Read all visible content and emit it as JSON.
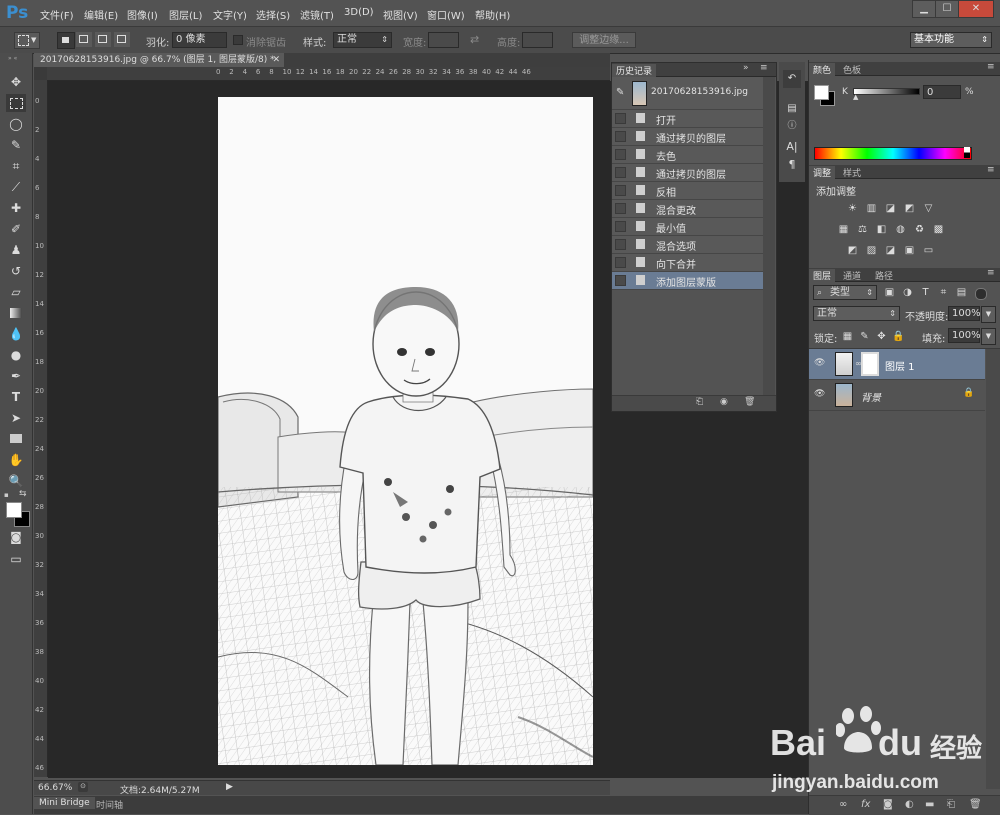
{
  "app": {
    "logo": "Ps"
  },
  "menu": [
    "文件(F)",
    "编辑(E)",
    "图像(I)",
    "图层(L)",
    "文字(Y)",
    "选择(S)",
    "滤镜(T)",
    "3D(D)",
    "视图(V)",
    "窗口(W)",
    "帮助(H)"
  ],
  "window_controls": [
    "▁",
    "☐",
    "✕"
  ],
  "options": {
    "feather_label": "羽化:",
    "feather_value": "0 像素",
    "antialias": "消除锯齿",
    "style_label": "样式:",
    "style_value": "正常",
    "width_label": "宽度:",
    "height_label": "高度:",
    "refine_edge": "调整边缘...",
    "workspace": "基本功能"
  },
  "document": {
    "tab_title": "20170628153916.jpg @ 66.7% (图层 1, 图层蒙版/8) *",
    "zoom": "66.67%",
    "doc_size": "文档:2.64M/5.27M",
    "ruler_top": [
      "0",
      "2",
      "4",
      "6",
      "8",
      "10",
      "12",
      "14",
      "16",
      "18",
      "20",
      "22",
      "24",
      "26",
      "28",
      "30",
      "32",
      "34",
      "36",
      "38",
      "40",
      "42",
      "44",
      "46"
    ],
    "ruler_left": [
      "0",
      "2",
      "4",
      "6",
      "8",
      "10",
      "12",
      "14",
      "16",
      "18",
      "20",
      "22",
      "24",
      "26",
      "28",
      "30",
      "32",
      "34",
      "36",
      "38",
      "40",
      "42",
      "44",
      "46"
    ]
  },
  "bottom_tabs": [
    "Mini Bridge",
    "时间轴"
  ],
  "history": {
    "title": "历史记录",
    "snapshot": "20170628153916.jpg",
    "items": [
      "打开",
      "通过拷贝的图层",
      "去色",
      "通过拷贝的图层",
      "反相",
      "混合更改",
      "最小值",
      "混合选项",
      "向下合并",
      "添加图层蒙版"
    ],
    "selected_index": 9
  },
  "color_panel": {
    "tabs": [
      "颜色",
      "色板"
    ],
    "channel": "K",
    "value": "0",
    "unit": "%"
  },
  "adjustments_panel": {
    "tabs": [
      "调整",
      "样式"
    ],
    "title": "添加调整"
  },
  "layers_panel": {
    "tabs": [
      "图层",
      "通道",
      "路径"
    ],
    "filter": "类型",
    "blend_mode": "正常",
    "opacity_label": "不透明度:",
    "opacity": "100%",
    "lock_label": "锁定:",
    "fill_label": "填充:",
    "fill": "100%",
    "layers": [
      {
        "name": "图层 1",
        "selected": true
      },
      {
        "name": "背景",
        "locked": true
      }
    ]
  },
  "watermark": {
    "brand": "Bai",
    "brand2": "du",
    "suffix": "经验",
    "url": "jingyan.baidu.com"
  }
}
